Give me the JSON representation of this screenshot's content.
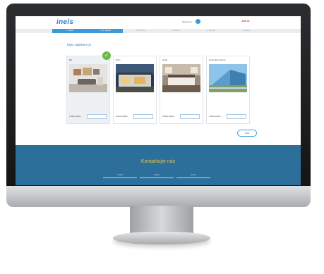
{
  "header": {
    "logo": "inels",
    "link_text": "Nastavení",
    "language": "Jiné z1"
  },
  "steps": [
    "1. Objekt",
    "2. Typ objektu",
    "3. Místnosti",
    "4. Funkce",
    "5. Kontakt",
    "6. Souhrn"
  ],
  "main": {
    "title": "Mým objektem je",
    "cards": [
      {
        "title": "Byt",
        "label": "Velikost objektu",
        "value": "",
        "selected": true
      },
      {
        "title": "Dům",
        "label": "Velikost objektu",
        "value": ""
      },
      {
        "title": "Hotel",
        "label": "Velikost objektu",
        "value": ""
      },
      {
        "title": "Komerční budova",
        "label": "Velikost objektu",
        "value": ""
      }
    ],
    "next_button": "Dále"
  },
  "contact": {
    "title": "Kontaktujte nás",
    "fields": [
      "E-mail",
      "Telefon",
      "Jméno"
    ]
  },
  "colors": {
    "accent": "#3a9ad9",
    "footer": "#2c6f9a",
    "footer_title": "#f0c23a",
    "check": "#69b84a"
  }
}
